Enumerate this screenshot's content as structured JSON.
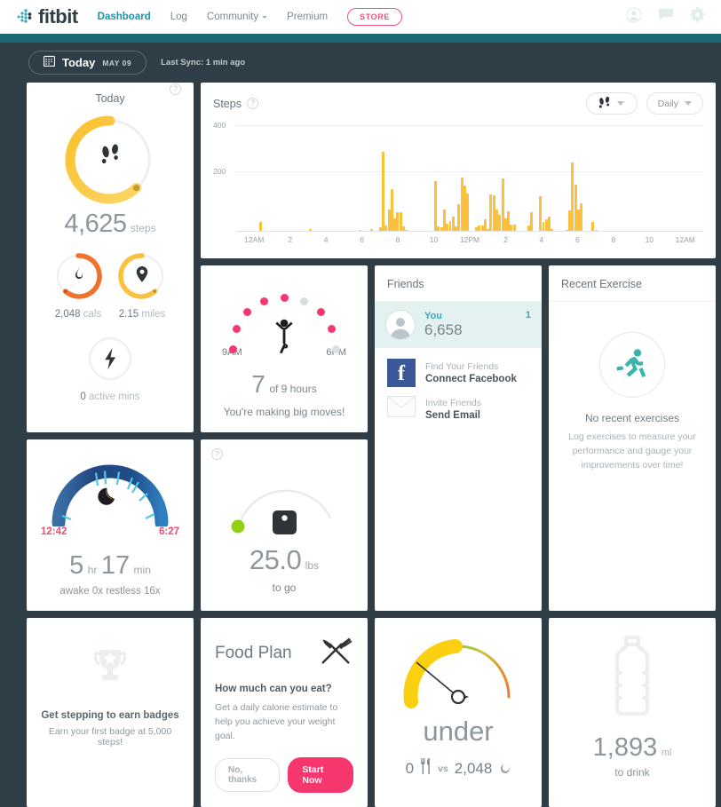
{
  "brand": {
    "name": "fitbit",
    "accent": "#1f93a6",
    "pink": "#f5376e",
    "yellow": "#fbc13e"
  },
  "nav": {
    "links": [
      {
        "label": "Dashboard",
        "active": true,
        "caret": false
      },
      {
        "label": "Log",
        "active": false,
        "caret": false
      },
      {
        "label": "Community",
        "active": false,
        "caret": true
      },
      {
        "label": "Premium",
        "active": false,
        "caret": false
      }
    ],
    "store_label": "STORE",
    "icons": [
      "account-icon",
      "messages-icon",
      "settings-gear-icon"
    ]
  },
  "datebar": {
    "calendar_icon": "calendar-icon",
    "today_label": "Today",
    "date_label": "MAY 09",
    "last_sync": "Last Sync: 1 min ago"
  },
  "today_card": {
    "title": "Today",
    "help": "?",
    "steps_value": "4,625",
    "steps_unit": "steps",
    "steps_progress_pct": 46,
    "metrics": [
      {
        "icon": "flame-icon",
        "value": "2,048",
        "unit": "cals",
        "progress_pct": 70,
        "color": "#f2722d"
      },
      {
        "icon": "map-pin-icon",
        "value": "2.15",
        "unit": "miles",
        "progress_pct": 46,
        "color": "#fbc13e"
      },
      {
        "icon": "lightning-bolt-icon",
        "value": "0",
        "unit": "active mins",
        "progress_pct": 0,
        "color": "#fbc13e"
      }
    ]
  },
  "steps_card": {
    "title": "Steps",
    "help": "?",
    "type_selector": {
      "icon": "footprints-icon",
      "label": ""
    },
    "period_selector": {
      "label": "Daily"
    }
  },
  "chart_data": {
    "type": "bar",
    "title": "Steps",
    "xlabel": "",
    "ylabel": "",
    "ylim": [
      0,
      430
    ],
    "yticks": [
      200,
      400
    ],
    "ytick_labels": [
      "200",
      "400"
    ],
    "grid": true,
    "legend": false,
    "x_tick_labels": [
      "12AM",
      "2",
      "4",
      "6",
      "8",
      "10",
      "12PM",
      "2",
      "4",
      "6",
      "8",
      "10",
      "12AM"
    ],
    "bin_minutes": 15,
    "bar_color": "#fbc13e",
    "values": [
      0,
      0,
      0,
      0,
      0,
      0,
      0,
      0,
      40,
      0,
      0,
      0,
      0,
      0,
      0,
      0,
      0,
      0,
      0,
      0,
      0,
      0,
      0,
      0,
      0,
      8,
      0,
      0,
      0,
      0,
      0,
      0,
      0,
      0,
      0,
      0,
      0,
      0,
      0,
      0,
      0,
      0,
      6,
      0,
      0,
      0,
      9,
      0,
      0,
      15,
      370,
      25,
      100,
      195,
      60,
      85,
      85,
      22,
      6,
      0,
      0,
      0,
      0,
      0,
      0,
      0,
      0,
      0,
      230,
      20,
      18,
      100,
      35,
      45,
      65,
      22,
      125,
      250,
      210,
      175,
      0,
      0,
      15,
      25,
      25,
      55,
      10,
      170,
      165,
      100,
      75,
      245,
      60,
      90,
      30,
      30,
      0,
      0,
      0,
      0,
      25,
      85,
      0,
      0,
      160,
      40,
      55,
      65,
      10,
      0,
      0,
      0,
      0,
      5,
      95,
      320,
      215,
      100,
      130,
      0,
      0,
      0,
      40,
      6,
      0,
      0,
      0,
      0,
      0,
      0,
      0,
      0,
      0,
      0,
      0,
      0,
      0,
      0,
      0,
      0,
      0,
      0,
      0,
      0,
      0,
      0,
      0,
      0,
      0,
      0,
      0,
      0,
      0,
      0,
      0,
      0,
      0,
      0,
      0,
      0
    ]
  },
  "hourly_card": {
    "start_time": "9AM",
    "end_time": "6PM",
    "figure_icon": "person-stretching-icon",
    "hours_done": "7",
    "hours_goal_text": "of 9 hours",
    "message": "You're making big moves!",
    "dots_total": 9,
    "dots_active": 7,
    "active_color": "#f5376e",
    "inactive_color": "#d9dee0"
  },
  "friends_card": {
    "title": "Friends",
    "me": {
      "avatar": "avatar-icon",
      "name": "You",
      "steps": "6,658",
      "rank": "1"
    },
    "actions": [
      {
        "icon": "facebook-icon",
        "sub": "Find Your Friends",
        "main": "Connect Facebook"
      },
      {
        "icon": "envelope-icon",
        "sub": "Invite Friends",
        "main": "Send Email"
      }
    ]
  },
  "exercise_card": {
    "title": "Recent Exercise",
    "icon": "running-person-icon",
    "empty_title": "No recent exercises",
    "empty_desc": "Log exercises to measure your performance and gauge your improvements over time!"
  },
  "sleep_card": {
    "icon": "moon-icon",
    "start_time": "12:42",
    "end_time": "6:27",
    "hours": "5",
    "hours_unit": "hr",
    "minutes": "17",
    "minutes_unit": "min",
    "sub": "awake 0x   restless 16x"
  },
  "weight_card": {
    "help": "?",
    "icon": "scale-icon",
    "value": "25.0",
    "unit": "lbs",
    "sub": "to go",
    "marker_color": "#92d013"
  },
  "badges_card": {
    "icon": "trophy-icon",
    "title": "Get stepping to earn badges",
    "sub": "Earn your first badge at 5,000 steps!"
  },
  "food_card": {
    "title": "Food Plan",
    "icon": "fork-knife-icon",
    "question": "How much can you eat?",
    "desc": "Get a daily calorie estimate to help you achieve your weight goal.",
    "decline_label": "No, thanks",
    "accept_label": "Start Now"
  },
  "calories_card": {
    "status": "under",
    "consumed": "0",
    "consumed_icon": "fork-knife-icon",
    "vs": "vs",
    "burned": "2,048",
    "burned_icon": "flame-icon"
  },
  "water_card": {
    "icon": "water-bottle-icon",
    "value": "1,893",
    "unit": "ml",
    "sub": "to drink"
  }
}
